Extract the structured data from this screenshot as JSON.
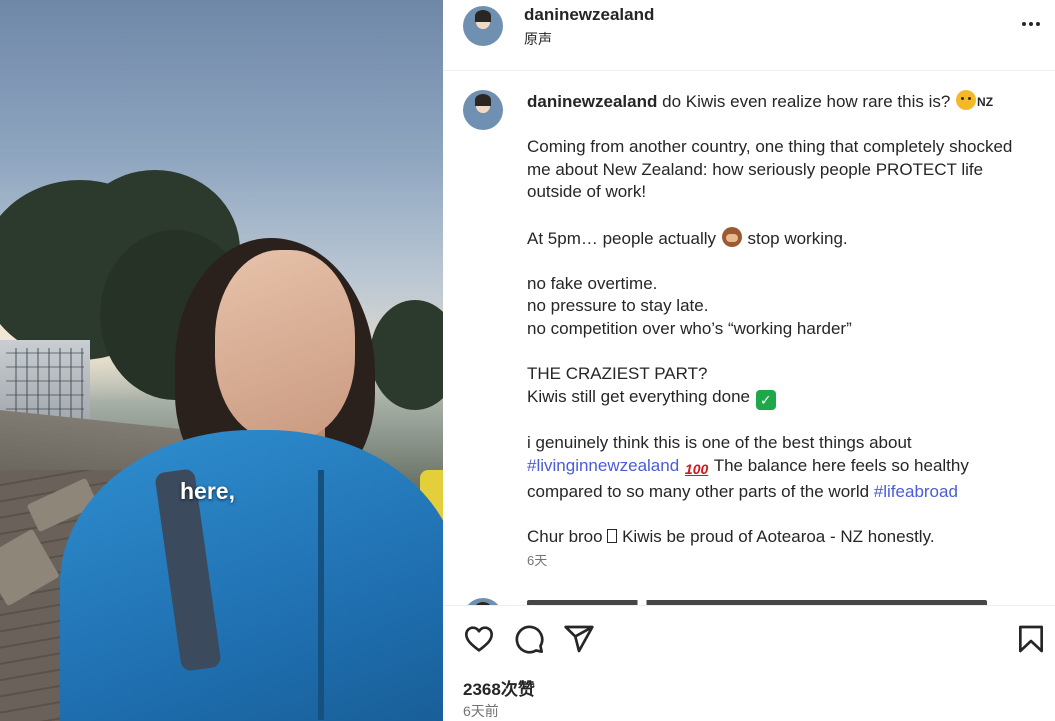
{
  "video": {
    "caption": "here,"
  },
  "header": {
    "username": "daninewzealand",
    "audio": "原声",
    "more_icon": "more-horizontal-icon"
  },
  "post": {
    "username": "daninewzealand",
    "intro": "do Kiwis even realize how rare this is?",
    "intro_flag": "NZ",
    "p1": "Coming from another country, one thing that completely shocked me about New Zealand: how seriously people PROTECT life outside of work!",
    "p2_a": "At 5pm… people actually",
    "p2_b": "stop working.",
    "l1": "no fake overtime.",
    "l2": "no pressure to stay late.",
    "l3": "no competition over who’s “working harder”",
    "c1": "THE CRAZIEST PART?",
    "c2": "Kiwis still get everything done",
    "t1": "i genuinely think this is one of the best things about",
    "hashtag1": "#livinginnewzealand",
    "emoji_100": "100",
    "t2": "The balance here feels so healthy",
    "t3": "compared to so many other parts of the world",
    "hashtag2": "#lifeabroad",
    "last_a": "Chur broo",
    "last_b": "Kiwis be proud of Aotearoa - NZ honestly.",
    "age": "6天"
  },
  "actions": {
    "like_icon": "heart-icon",
    "comment_icon": "comment-icon",
    "share_icon": "share-icon",
    "save_icon": "bookmark-icon",
    "likes": "2368次赞",
    "date": "6天前"
  },
  "colors": {
    "hashtag": "#4a5cd9",
    "meta_gray": "#737373",
    "jacket_blue": "#2f8fd0"
  }
}
